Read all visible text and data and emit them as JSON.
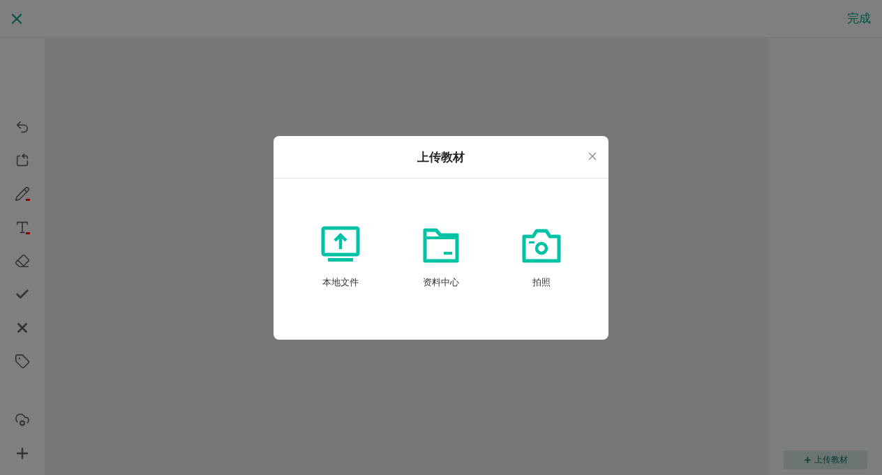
{
  "top_bar": {
    "done": "完成"
  },
  "tools": [
    {
      "kind": "undo"
    },
    {
      "kind": "rotate"
    },
    {
      "kind": "pen",
      "color": "#8b0000"
    },
    {
      "kind": "text",
      "color": "#8b0000"
    },
    {
      "kind": "eraser"
    },
    {
      "kind": "check"
    },
    {
      "kind": "cross"
    },
    {
      "kind": "tag"
    },
    {
      "kind": "gap"
    },
    {
      "kind": "cloud"
    },
    {
      "kind": "plus"
    }
  ],
  "side_panel": {
    "upload_button": "上传教材"
  },
  "dialog": {
    "title": "上传教材",
    "options": [
      {
        "kind": "local",
        "label": "本地文件"
      },
      {
        "kind": "folder",
        "label": "资料中心"
      },
      {
        "kind": "camera",
        "label": "拍照"
      }
    ]
  }
}
